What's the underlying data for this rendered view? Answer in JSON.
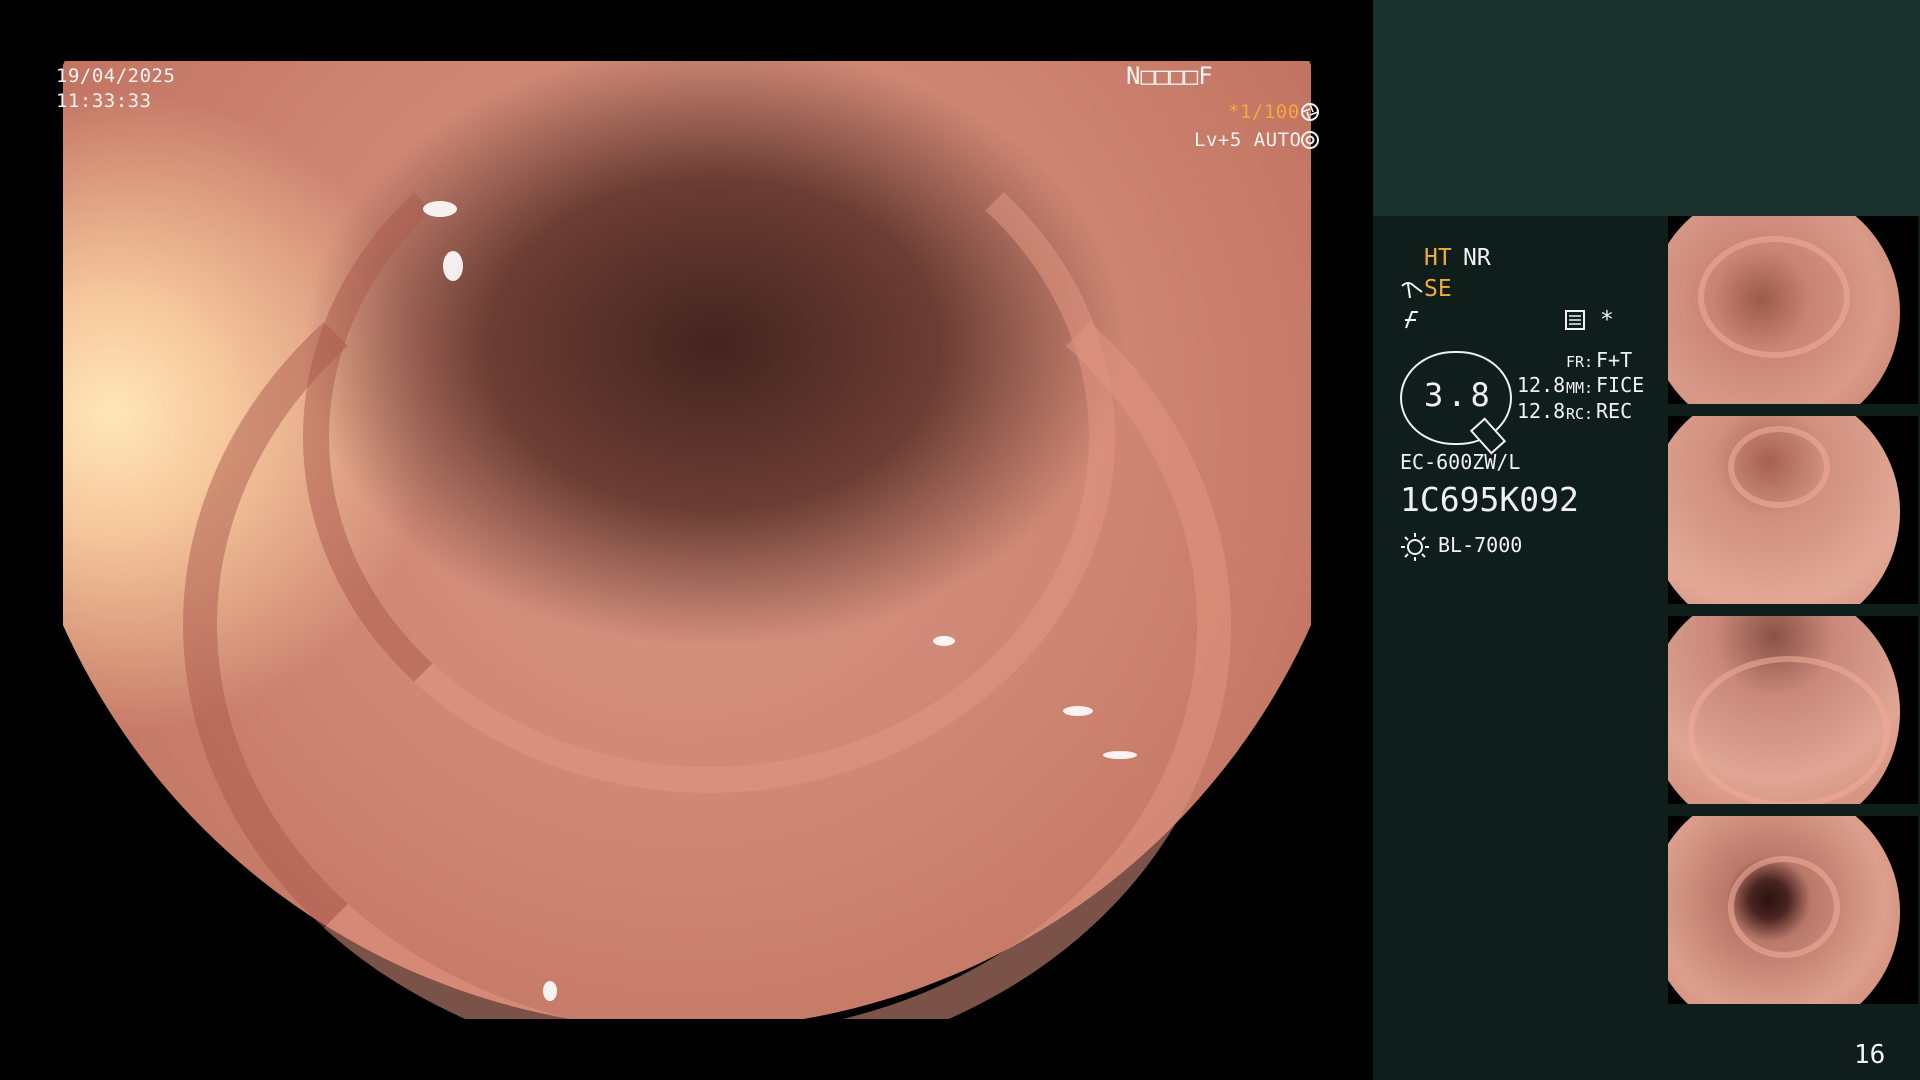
{
  "overlay": {
    "date": "19/04/2025",
    "time": "11:33:33",
    "patient_id": "N□□□□F",
    "shutter": "*1/100",
    "level": "Lv+5 AUTO",
    "shutter_icon": "aperture-icon",
    "auto_icon": "target-icon"
  },
  "panel": {
    "ht_label": "HT",
    "nr_label": "NR",
    "se_label": "SE",
    "se_icon": "enhance-icon",
    "f_icon": "function-icon",
    "menu_icon": "settings-panel-icon",
    "star": "*",
    "gauge_value": "3.8",
    "fr_value_1": "12.8",
    "fr_value_2": "12.8",
    "fr_key": "FR:",
    "fr_val": "F+T",
    "mm_key": "MM:",
    "mm_val": "FICE",
    "rc_key": "RC:",
    "rc_val": "REC",
    "scope_model": "EC-600ZW/L",
    "scope_serial": "1C695K092",
    "light_source": "BL-7000",
    "light_icon": "light-source-icon",
    "frame_count": "16"
  },
  "colors": {
    "accent_orange": "#f4a93a",
    "panel_bg": "#0f1d1b",
    "panel_header_bg": "#1b312d",
    "mucosa": "#cf8774"
  },
  "thumbnails": [
    {
      "label": "thumbnail-1"
    },
    {
      "label": "thumbnail-2"
    },
    {
      "label": "thumbnail-3"
    },
    {
      "label": "thumbnail-4"
    }
  ]
}
